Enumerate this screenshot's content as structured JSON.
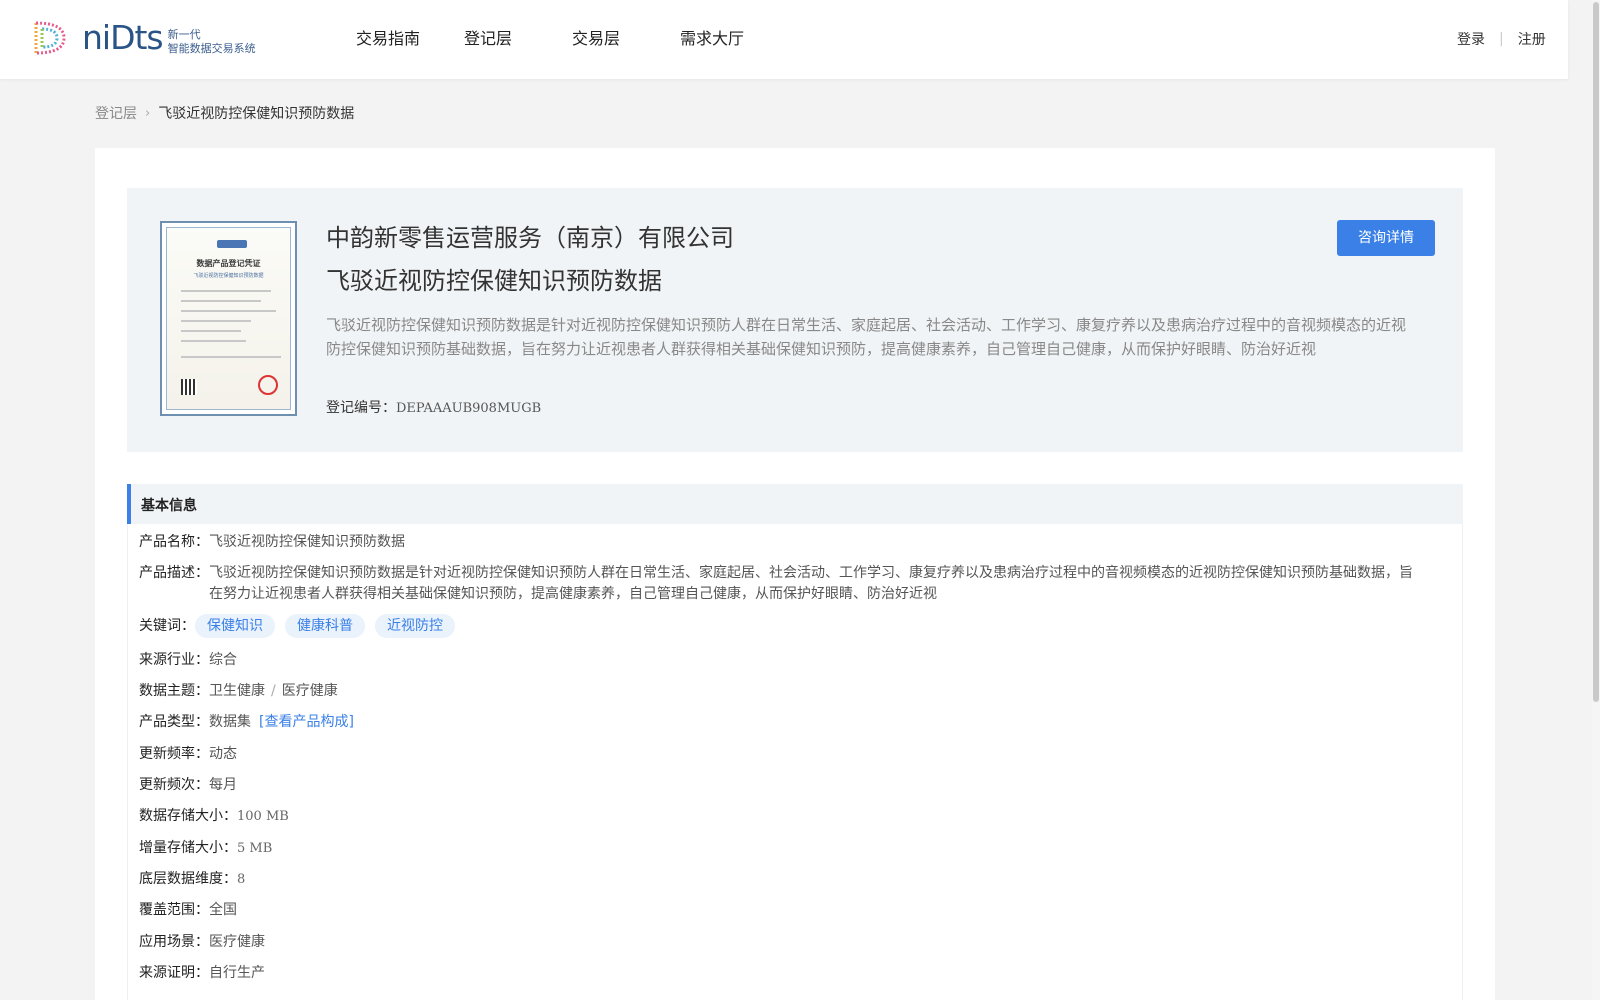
{
  "header": {
    "logo_word": "niDts",
    "logo_sub_1": "新一代",
    "logo_sub_2": "智能数据交易系统",
    "nav": [
      "交易指南",
      "登记层",
      "交易层",
      "需求大厅"
    ],
    "login": "登录",
    "divider": "|",
    "register": "注册"
  },
  "breadcrumb": {
    "parent": "登记层",
    "separator": "›",
    "current": "飞驳近视防控保健知识预防数据"
  },
  "summary": {
    "company": "中韵新零售运营服务（南京）有限公司",
    "product_title": "飞驳近视防控保健知识预防数据",
    "description": "飞驳近视防控保健知识预防数据是针对近视防控保健知识预防人群在日常生活、家庭起居、社会活动、工作学习、康复疗养以及患病治疗过程中的音视频模态的近视防控保健知识预防基础数据，旨在努力让近视患者人群获得相关基础保健知识预防，提高健康素养，自己管理自己健康，从而保护好眼睛、防治好近视",
    "reg_label": "登记编号：",
    "reg_value": "DEPAAAUB908MUGB",
    "consult_button": "咨询详情",
    "certificate": {
      "title": "数据产品登记凭证"
    }
  },
  "basic_info": {
    "section_title": "基本信息",
    "product_name_label": "产品名称：",
    "product_name": "飞驳近视防控保健知识预防数据",
    "product_desc_label": "产品描述：",
    "product_desc": "飞驳近视防控保健知识预防数据是针对近视防控保健知识预防人群在日常生活、家庭起居、社会活动、工作学习、康复疗养以及患病治疗过程中的音视频模态的近视防控保健知识预防基础数据，旨在努力让近视患者人群获得相关基础保健知识预防，提高健康素养，自己管理自己健康，从而保护好眼睛、防治好近视",
    "keywords_label": "关键词：",
    "keywords": [
      "保健知识",
      "健康科普",
      "近视防控"
    ],
    "industry_label": "来源行业：",
    "industry": "综合",
    "topic_label": "数据主题：",
    "topic_main": "卫生健康",
    "topic_sep": "/",
    "topic_sub": "医疗健康",
    "type_label": "产品类型：",
    "type": "数据集",
    "type_link": "[查看产品构成]",
    "update_freq_label": "更新频率：",
    "update_freq": "动态",
    "update_times_label": "更新频次：",
    "update_times": "每月",
    "storage_label": "数据存储大小：",
    "storage": "100 MB",
    "increment_label": "增量存储大小：",
    "increment": "5 MB",
    "dimension_label": "底层数据维度：",
    "dimension": "8",
    "coverage_label": "覆盖范围：",
    "coverage": "全国",
    "scenario_label": "应用场景：",
    "scenario": "医疗健康",
    "proof_label": "来源证明：",
    "proof": "自行生产"
  },
  "colors": {
    "accent": "#3a80e6",
    "panel_bg": "#f1f4f7",
    "page_bg": "#f3f3f3"
  }
}
